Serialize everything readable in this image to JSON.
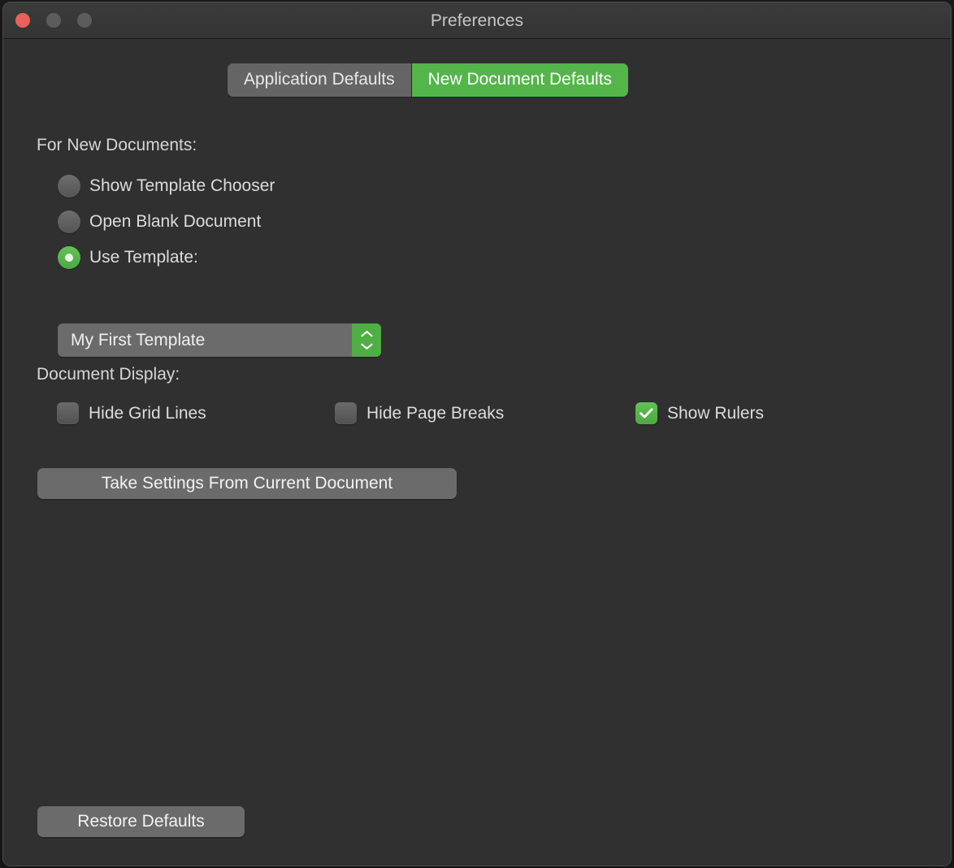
{
  "window": {
    "title": "Preferences",
    "traffic_lights": [
      {
        "name": "close-button",
        "color": "#e8615a"
      },
      {
        "name": "minimize-button",
        "color": "#5c5c5e"
      },
      {
        "name": "zoom-button",
        "color": "#5c5c5e"
      }
    ],
    "background": "#303031",
    "titlebar_background": "#3b3b3c"
  },
  "theme": {
    "accent_green": "#54b54a",
    "control_gray": "#6b6b6b",
    "text_primary": "#dcdcdc",
    "text_title": "#c6c6c6"
  },
  "tabs": {
    "items": [
      {
        "label": "Application Defaults",
        "selected": false
      },
      {
        "label": "New Document Defaults",
        "selected": true
      }
    ]
  },
  "sections": {
    "for_new_documents": {
      "label": "For New Documents:",
      "radios": [
        {
          "label": "Show Template Chooser",
          "selected": false
        },
        {
          "label": "Open Blank Document",
          "selected": false
        },
        {
          "label": "Use Template:",
          "selected": true
        }
      ],
      "template_popup": {
        "value": "My First Template",
        "stepper_icon": "chevron-up-down-icon"
      }
    },
    "document_display": {
      "label": "Document Display:",
      "checkboxes": [
        {
          "label": "Hide Grid Lines",
          "checked": false
        },
        {
          "label": "Hide Page Breaks",
          "checked": false
        },
        {
          "label": "Show Rulers",
          "checked": true
        }
      ]
    }
  },
  "buttons": {
    "take_settings": "Take Settings From Current Document",
    "restore_defaults": "Restore Defaults"
  }
}
